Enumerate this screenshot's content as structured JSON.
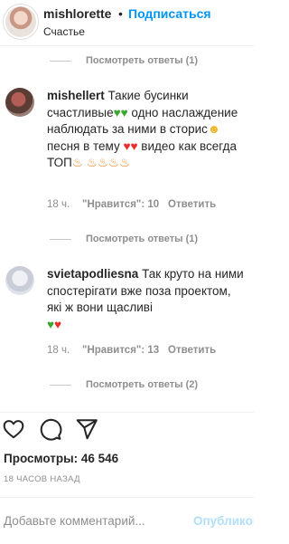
{
  "header": {
    "username": "mishlorette",
    "dot": "•",
    "follow_label": "Подписаться",
    "location": "Счастье"
  },
  "replies_top": {
    "label": "Посмотреть ответы (1)"
  },
  "comment1": {
    "username": "mishellert",
    "text_a": "Такие бусинки счастливые",
    "text_b": "одно наслаждение наблюдать за ними в сторис",
    "text_c": "песня в тему",
    "text_d": "видео как всегда ТОП",
    "time": "18 ч.",
    "likes": "\"Нравится\": 10",
    "reply": "Ответить",
    "view_replies": "Посмотреть ответы (1)"
  },
  "comment2": {
    "username": "svietapodliesna",
    "text": "Так круто на ними спостерігати вже поза проектом, які ж вони щасливі",
    "time": "18 ч.",
    "likes": "\"Нравится\": 13",
    "reply": "Ответить",
    "view_replies": "Посмотреть ответы (2)"
  },
  "stats": {
    "views": "Просмотры: 46 546",
    "time_ago": "18 ЧАСОВ НАЗАД"
  },
  "comment_box": {
    "placeholder": "Добавьте комментарий...",
    "publish_label": "Опубликовать"
  },
  "icons": [
    "heart-icon",
    "comment-icon",
    "share-icon"
  ]
}
